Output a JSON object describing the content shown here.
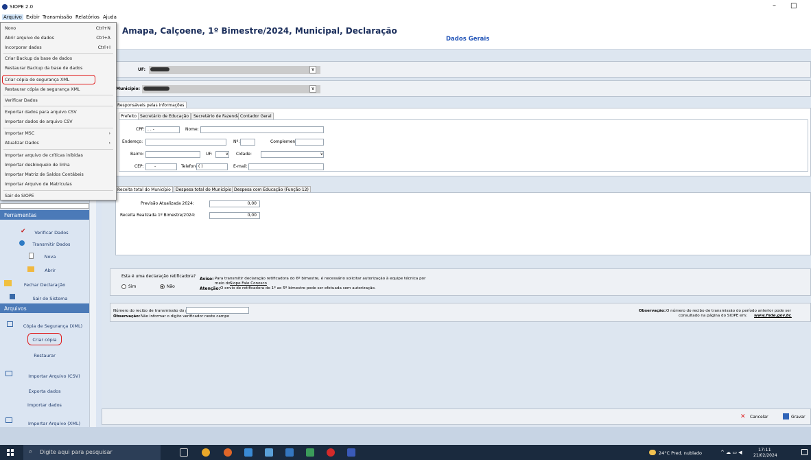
{
  "window": {
    "title": "SIOPE 2.0",
    "min": "–",
    "max": "□"
  },
  "menubar": {
    "items": [
      "Arquivo",
      "Exibir",
      "Transmissão",
      "Relatórios",
      "Ajuda"
    ]
  },
  "dropdown": {
    "items": [
      {
        "label": "Novo",
        "shortcut": "Ctrl+N"
      },
      {
        "label": "Abrir arquivo de dados",
        "shortcut": "Ctrl+A"
      },
      {
        "label": "Incorporar dados",
        "shortcut": "Ctrl+I"
      },
      {
        "label": "Criar Backup da base de dados",
        "shortcut": ""
      },
      {
        "label": "Restaurar Backup da base de dados",
        "shortcut": ""
      },
      {
        "label": "Criar cópia de segurança XML",
        "shortcut": ""
      },
      {
        "label": "Restaurar cópia de segurança XML",
        "shortcut": ""
      },
      {
        "label": "Verificar Dados",
        "shortcut": ""
      },
      {
        "label": "Exportar dados para arquivo CSV",
        "shortcut": ""
      },
      {
        "label": "Importar dados de arquivo CSV",
        "shortcut": ""
      },
      {
        "label": "Importar MSC",
        "shortcut": "›"
      },
      {
        "label": "Atualizar Dados",
        "shortcut": "›"
      },
      {
        "label": "Importar arquivo de críticas inibidas",
        "shortcut": ""
      },
      {
        "label": "Importar desbloqueio de linha",
        "shortcut": ""
      },
      {
        "label": "Importar Matriz de Saldos Contábeis",
        "shortcut": ""
      },
      {
        "label": "Importar Arquivo de Matrículas",
        "shortcut": ""
      },
      {
        "label": "Sair do SIOPE",
        "shortcut": ""
      }
    ]
  },
  "header": {
    "title": "Amapa, Calçoene, 1º Bimestre/2024, Municipal, Declaração",
    "subtitle": "Dados Gerais"
  },
  "uf": {
    "label": "UF:"
  },
  "municipio": {
    "label": "Município:"
  },
  "resp": {
    "tab": "Responsáveis pelas informações",
    "subtabs": [
      "Prefeito",
      "Secretário de Educação",
      "Secretário de Fazenda",
      "Contador Geral"
    ],
    "cpf": "CPF:",
    "cpf_value": ". . -",
    "nome": "Nome:",
    "endereco": "Endereço:",
    "numero": "Nº:",
    "complemento": "Complemento:",
    "bairro": "Bairro:",
    "uf": "UF:",
    "cidade": "Cidade:",
    "cep": "CEP:",
    "cep_value": "-",
    "telefone": "Telefone:",
    "telefone_value": "( )",
    "email": "E-mail:"
  },
  "receita": {
    "tabs": [
      "Receita total do Município",
      "Despesa total do Município",
      "Despesa com Educação (Função 12)"
    ],
    "prev_label": "Previsão Atualizada 2024:",
    "prev_value": "0,00",
    "real_label": "Receita Realizada 1º Bimestre/2024:",
    "real_value": "0,00"
  },
  "retificadora": {
    "question": "Esta é uma declaração retificadora?",
    "sim": "Sim",
    "nao": "Não",
    "aviso_b": "Aviso:",
    "aviso": "Para transmitir declaração retificadora do 6º bimestre, é necessário solicitar autorização à equipe técnica por",
    "aviso2": "meio do",
    "link": "Siope Fale Conosco",
    "atencao_b": "Atenção:",
    "atencao": "O envio de retificadora do 1º ao 5º bimestre pode ser efetuada sem autorização."
  },
  "recibo": {
    "label": "Número do recibo de transmissão do período anterior",
    "obs_b": "Observação:",
    "obs": "Não informar o digito verificador neste campo",
    "obs2_b": "Observação:",
    "obs2": "O número do recibo de transmissão do período anterior pode ser",
    "obs2b": "consultado na página do SIOPE em:",
    "obs2_link": "www.fnde.gov.br."
  },
  "buttons": {
    "cancelar": "Cancelar",
    "gravar": "Gravar"
  },
  "sidebar": {
    "ferramentas": "Ferramentas",
    "ferr_items": [
      "Verificar Dados",
      "Transmitir Dados",
      "Nova",
      "Abrir",
      "Fechar Declaração",
      "Sair do Sistema"
    ],
    "arquivos": "Arquivos",
    "copia": "Cópia de Segurança (XML)",
    "criar": "Criar cópia",
    "restaurar": "Restaurar",
    "csv": "Importar Arquivo (CSV)",
    "exporta": "Exporta dados",
    "importar": "Importar dados",
    "xml": "Importar Arquivo (XML)"
  },
  "taskbar": {
    "search": "Digite aqui para pesquisar",
    "weather": "24°C  Pred. nublado",
    "time": "17:11",
    "date": "21/02/2024"
  }
}
